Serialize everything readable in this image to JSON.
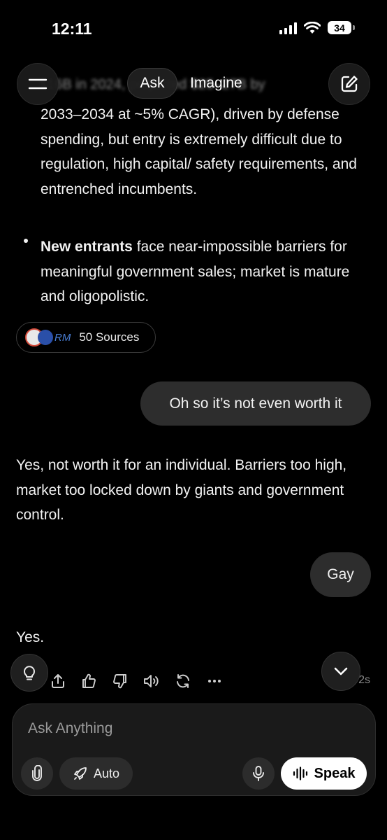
{
  "status_bar": {
    "time": "12:11",
    "battery": "34"
  },
  "nav": {
    "ask_label": "Ask",
    "imagine_label": "Imagine",
    "scrolled_fragment": "$16B in 2024, projected $25–27B by"
  },
  "message_partial": {
    "text": "2033–2034 at ~5% CAGR), driven by defense spending, but entry is extremely difficult due to regulation, high capital/ safety requirements, and entrenched incumbents.",
    "bullet_bold": "New entrants",
    "bullet_rest": " face near-impossible barriers for meaningful government sales; market is mature and oligopolistic."
  },
  "sources": {
    "logo_text": "RM",
    "label": "50 Sources"
  },
  "conversation": {
    "user_1": "Oh so it’s not even worth it",
    "assistant_1": "Yes, not worth it for an individual. Barriers too high, market too locked down by giants and government control.",
    "user_2": "Gay",
    "assistant_2": "Yes."
  },
  "actions": {
    "meta": "Fast · 2s"
  },
  "composer": {
    "placeholder": "Ask Anything",
    "auto_label": "Auto",
    "speak_label": "Speak"
  },
  "icons": [
    "menu-icon",
    "edit-icon",
    "lightbulb-icon",
    "share-icon",
    "thumbs-up-icon",
    "thumbs-down-icon",
    "speaker-icon",
    "regenerate-icon",
    "more-icon",
    "chevron-down-icon",
    "paperclip-icon",
    "rocket-icon",
    "microphone-icon",
    "waveform-icon"
  ]
}
